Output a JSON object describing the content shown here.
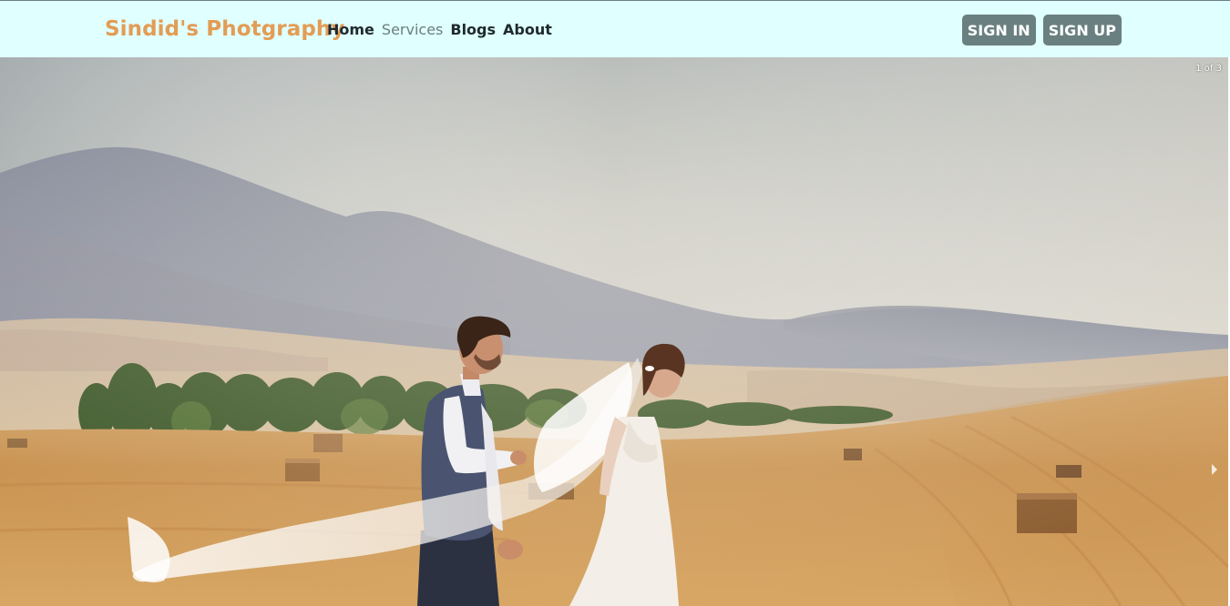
{
  "brand": {
    "name": "Sindid's Photgraphy",
    "color": "#e39c54"
  },
  "nav": {
    "items": [
      {
        "label": "Home",
        "state": "normal"
      },
      {
        "label": "Services",
        "state": "muted"
      },
      {
        "label": "Blogs",
        "state": "normal"
      },
      {
        "label": "About",
        "state": "normal"
      }
    ]
  },
  "auth": {
    "sign_in": "SIGN IN",
    "sign_up": "SIGN UP"
  },
  "carousel": {
    "counter": "1 of 3",
    "current": 1,
    "total": 3,
    "image_alt": "wedding-couple-in-wheat-field",
    "next_icon": "chevron-right-icon"
  },
  "colors": {
    "navbar_bg": "#e0ffff",
    "button_bg": "#6a8080",
    "muted_link": "#6c7c7f"
  }
}
